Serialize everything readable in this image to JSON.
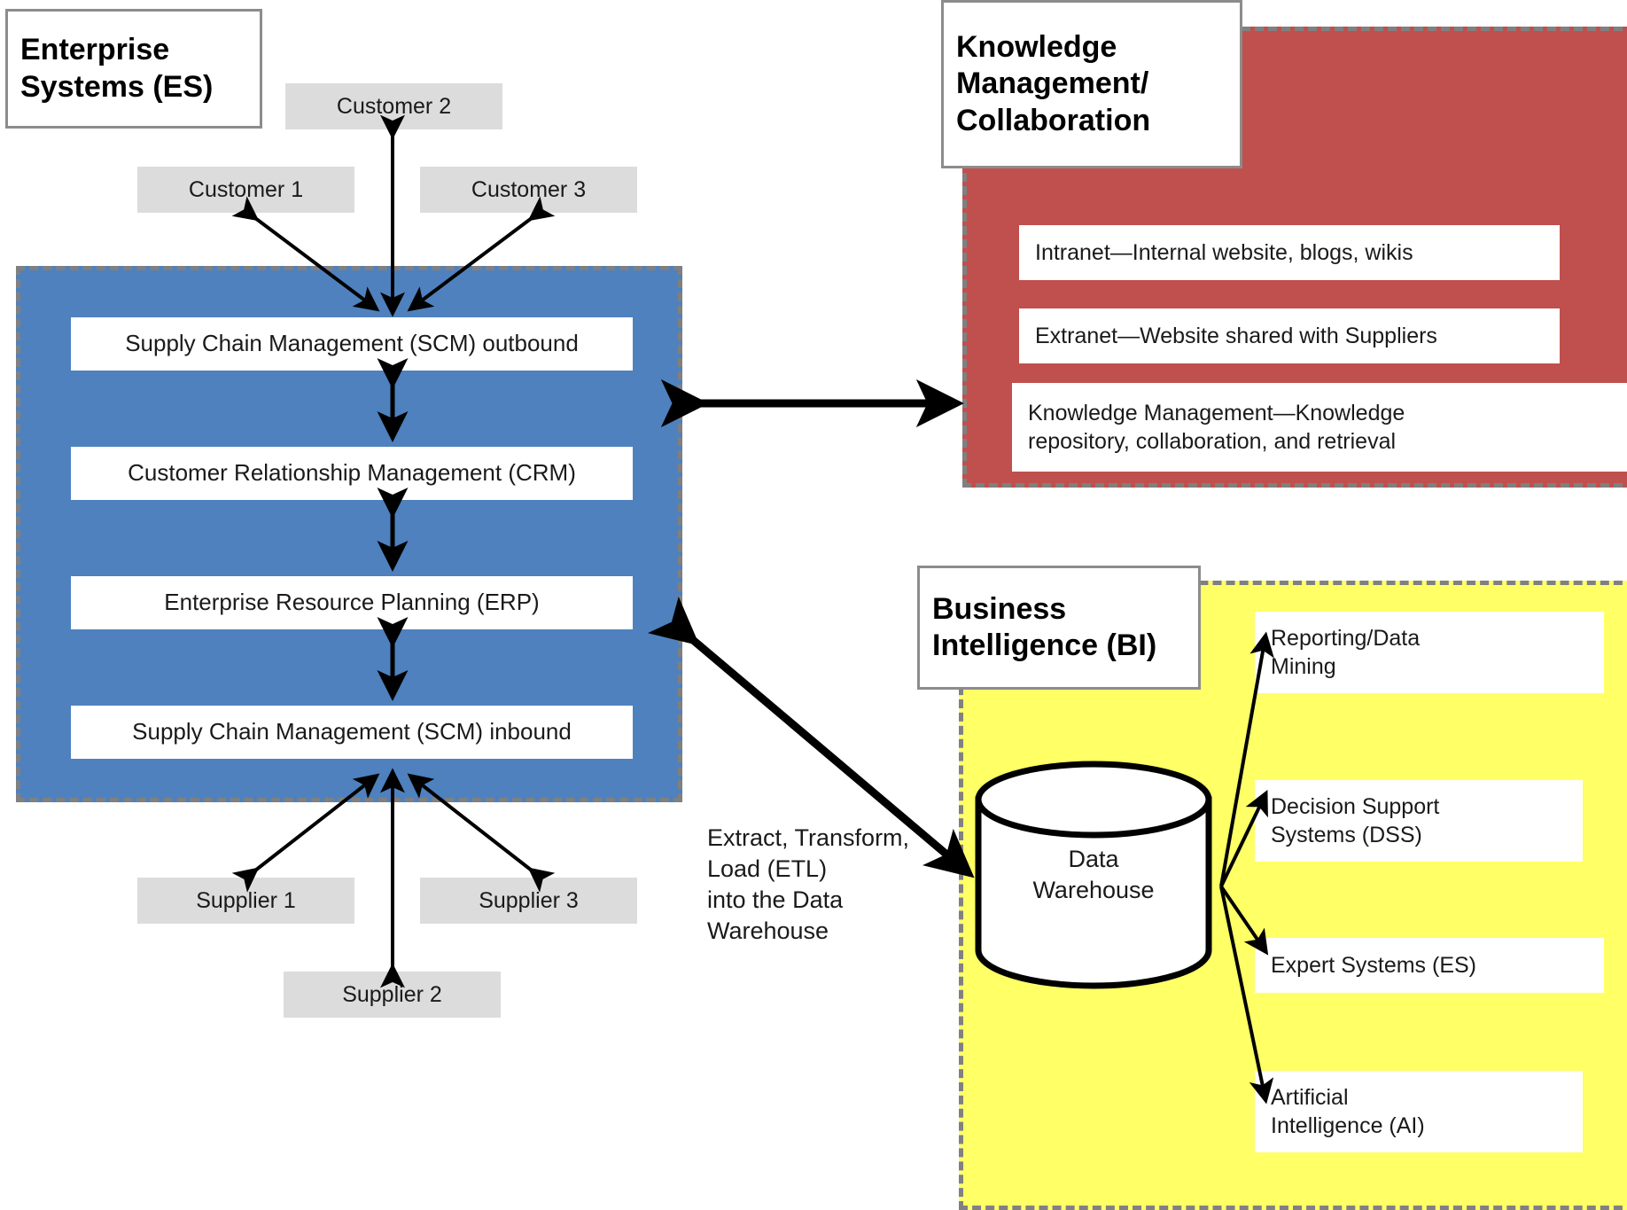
{
  "diagram": {
    "title": "Enterprise Information Systems Architecture",
    "colors": {
      "enterprise_systems_fill": "#4E81BE",
      "knowledge_management_fill": "#C0504D",
      "business_intelligence_fill": "#FFFF66",
      "entity_fill": "#DCDCDC",
      "card_fill": "#FFFFFF",
      "zone_border": "#808080",
      "arrow": "#000000"
    }
  },
  "zones": {
    "enterprise_systems": {
      "title": "Enterprise\nSystems (ES)",
      "title_line1": "Enterprise",
      "title_line2": "Systems (ES)",
      "cards": [
        {
          "label": "Supply Chain Management (SCM) outbound"
        },
        {
          "label": "Customer Relationship Management (CRM)"
        },
        {
          "label": "Enterprise Resource Planning (ERP)"
        },
        {
          "label": "Supply Chain Management (SCM) inbound"
        }
      ]
    },
    "knowledge_management": {
      "title_line1": "Knowledge",
      "title_line2": "Management/",
      "title_line3": "Collaboration",
      "cards": [
        {
          "label": "Intranet—Internal website, blogs, wikis"
        },
        {
          "label": "Extranet—Website shared with Suppliers"
        },
        {
          "label": "Knowledge Management—Knowledge\nrepository, collaboration, and retrieval"
        }
      ]
    },
    "business_intelligence": {
      "title_line1": "Business",
      "title_line2": "Intelligence (BI)",
      "datastore": {
        "label_line1": "Data",
        "label_line2": "Warehouse"
      },
      "cards": [
        {
          "label": "Reporting/Data\nMining"
        },
        {
          "label": "Decision Support\nSystems (DSS)"
        },
        {
          "label": "Expert Systems (ES)"
        },
        {
          "label": "Artificial\nIntelligence (AI)"
        }
      ]
    }
  },
  "entities": {
    "customers": [
      {
        "label": "Customer 1"
      },
      {
        "label": "Customer 2"
      },
      {
        "label": "Customer 3"
      }
    ],
    "suppliers": [
      {
        "label": "Supplier 1"
      },
      {
        "label": "Supplier 2"
      },
      {
        "label": "Supplier 3"
      }
    ]
  },
  "labels": {
    "etl": "Extract, Transform,\nLoad (ETL)\ninto the Data\nWarehouse"
  }
}
